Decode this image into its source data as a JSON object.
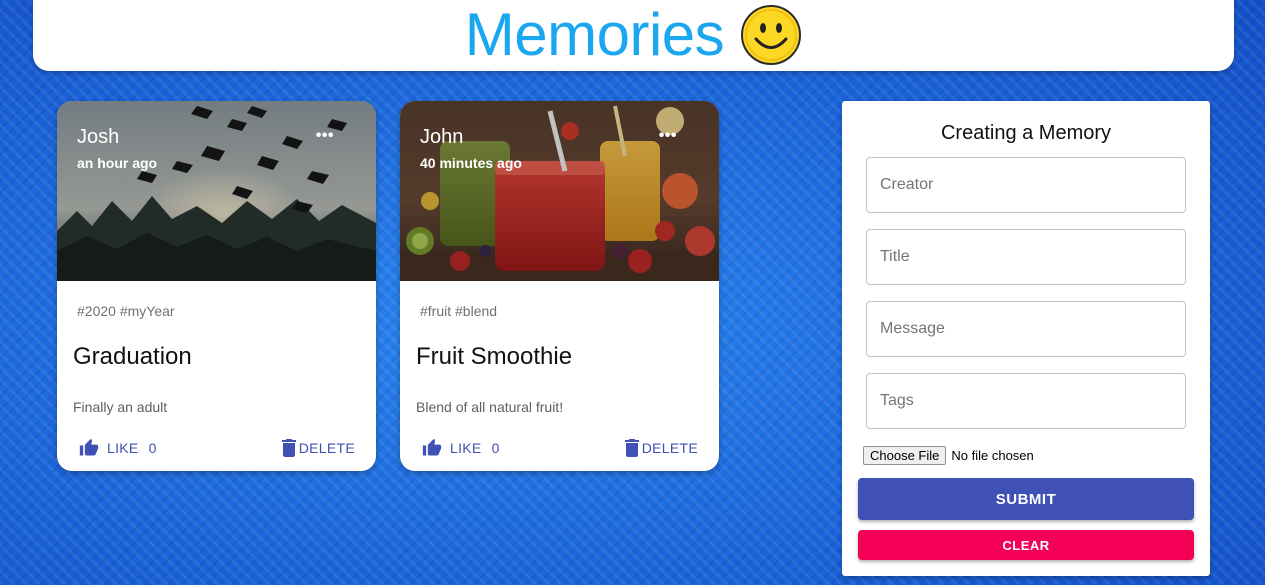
{
  "app": {
    "title": "Memories"
  },
  "posts": [
    {
      "creator": "Josh",
      "time": "an hour ago",
      "more_label": "•••",
      "tags": "#2020 #myYear",
      "title": "Graduation",
      "message": "Finally an adult",
      "like_label": "LIKE",
      "like_count": "0",
      "delete_label": "DELETE"
    },
    {
      "creator": "John",
      "time": "40 minutes ago",
      "more_label": "•••",
      "tags": "#fruit #blend",
      "title": "Fruit Smoothie",
      "message": "Blend of all natural fruit!",
      "like_label": "LIKE",
      "like_count": "0",
      "delete_label": "DELETE"
    }
  ],
  "form": {
    "heading": "Creating a Memory",
    "creator_placeholder": "Creator",
    "title_placeholder": "Title",
    "message_placeholder": "Message",
    "tags_placeholder": "Tags",
    "choose_file_label": "Choose File",
    "file_status": "No file chosen",
    "submit_label": "SUBMIT",
    "clear_label": "CLEAR"
  },
  "colors": {
    "brand": "#1aa7ef",
    "primary": "#3f51b5",
    "secondary": "#f50057",
    "background": "#1e6fe0"
  },
  "icons": [
    "smiley-icon",
    "more-horiz-icon",
    "thumb-up-icon",
    "trash-icon"
  ]
}
